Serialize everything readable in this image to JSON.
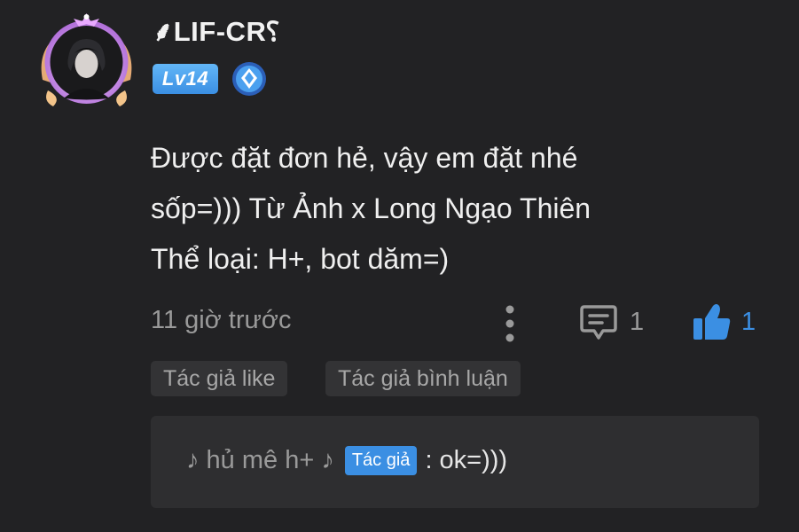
{
  "user": {
    "name": "⸙LIF-CR⸮",
    "level": "Lv14",
    "rank_icon": "diamond-rank-icon"
  },
  "comment": {
    "lines": [
      "Được đặt đơn hẻ, vậy em đặt nhé",
      "sốp=))) Từ Ảnh x Long Ngạo Thiên",
      "Thể loại: H+, bot dăm=)"
    ],
    "time": "11 giờ trước",
    "reply_count": "1",
    "like_count": "1"
  },
  "tags": [
    "Tác giả like",
    "Tác giả bình luận"
  ],
  "reply": {
    "author": "♪ hủ mê h+ ♪",
    "author_tag": "Tác giả",
    "text": ": ok=)))"
  },
  "colors": {
    "background": "#222224",
    "accent": "#3b8fe3",
    "muted": "#9a9a9a"
  }
}
